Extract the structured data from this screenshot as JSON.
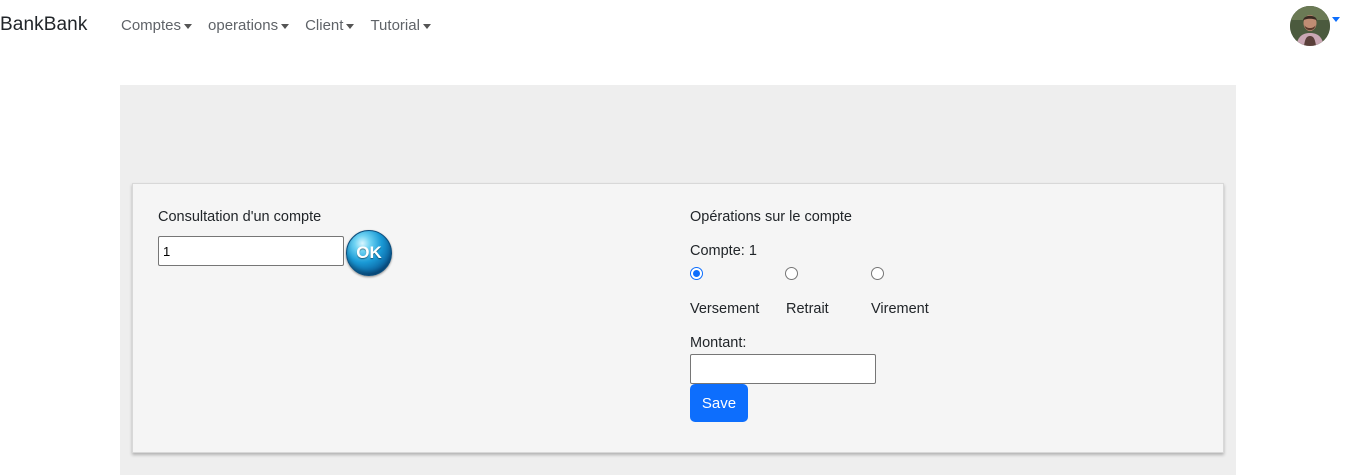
{
  "navbar": {
    "brand": "BankBank",
    "menu": [
      {
        "label": "Comptes"
      },
      {
        "label": "operations"
      },
      {
        "label": "Client"
      },
      {
        "label": "Tutorial"
      }
    ]
  },
  "consultation": {
    "title": "Consultation d'un compte",
    "account_input_value": "1",
    "ok_label": "OK"
  },
  "operations": {
    "title": "Opérations sur le compte",
    "account_line": "Compte: 1",
    "types": [
      {
        "label": "Versement",
        "checked": true
      },
      {
        "label": "Retrait",
        "checked": false
      },
      {
        "label": "Virement",
        "checked": false
      }
    ],
    "amount_label": "Montant:",
    "amount_value": "",
    "save_label": "Save"
  },
  "colors": {
    "accent": "#0d6efd",
    "panel_bg": "#eeeeee",
    "card_bg": "#f5f5f5"
  }
}
